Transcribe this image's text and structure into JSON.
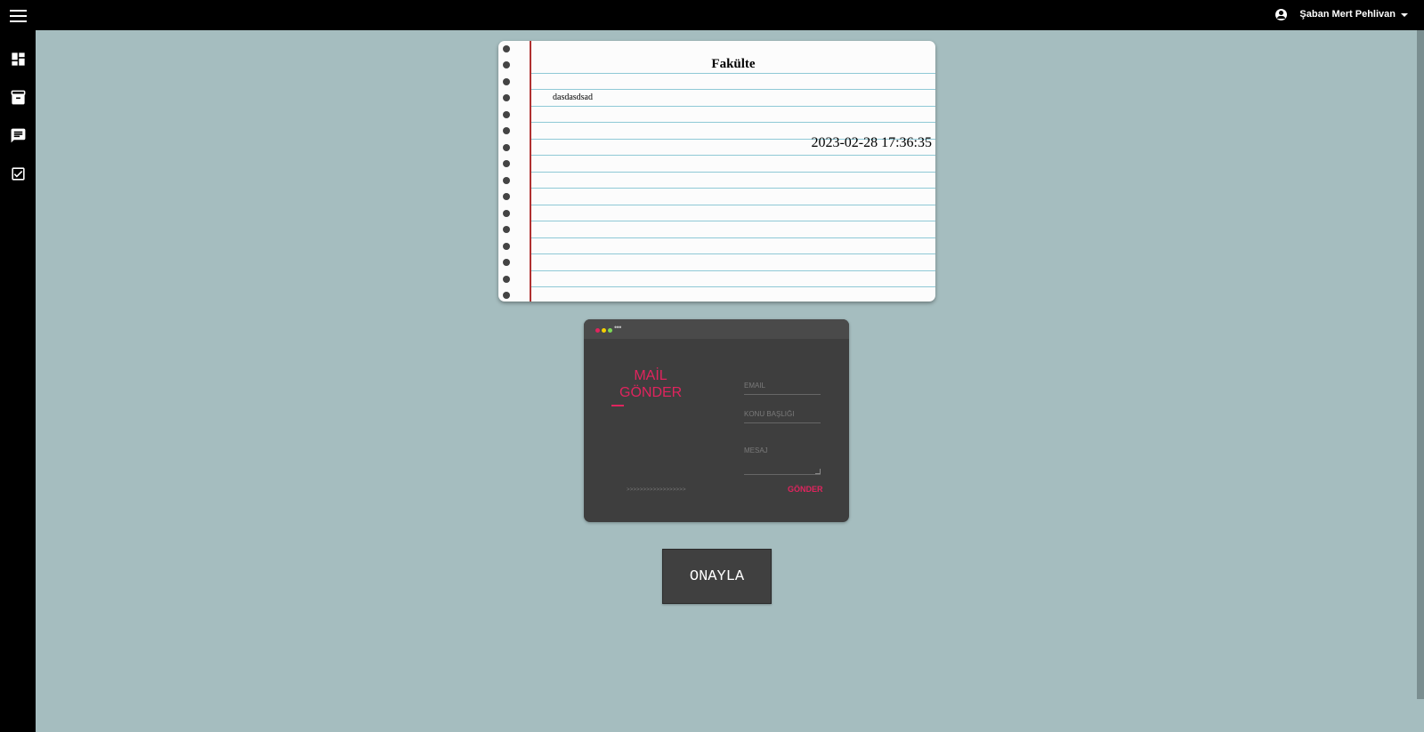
{
  "header": {
    "user_name": "Şaban Mert Pehlivan",
    "menu_icon": "hamburger-menu-icon",
    "user_icon": "account-circle-icon"
  },
  "sidebar": {
    "items": [
      {
        "icon": "dashboard-icon"
      },
      {
        "icon": "archive-icon"
      },
      {
        "icon": "message-icon"
      },
      {
        "icon": "checkbox-icon"
      }
    ]
  },
  "notebook": {
    "title": "Fakülte",
    "body": "dasdasdsad",
    "date": "2023-02-28 17:36:35"
  },
  "mail_form": {
    "title_line1": "MAİL",
    "title_line2": "GÖNDER",
    "email_placeholder": "EMAIL",
    "subject_placeholder": "KONU BAŞLIĞI",
    "message_placeholder": "MESAJ",
    "send_label": "GÖNDER",
    "footer_text": ">>>>>>>>>>>>>>>>>>",
    "accent_color": "#e0245e",
    "window_dots": [
      "#e0245e",
      "#f5d000",
      "#7ed957"
    ]
  },
  "confirm_button": {
    "label": "ONAYLA"
  },
  "colors": {
    "background": "#a5bdbf",
    "topbar": "#000000",
    "card": "#3e3e3e"
  }
}
